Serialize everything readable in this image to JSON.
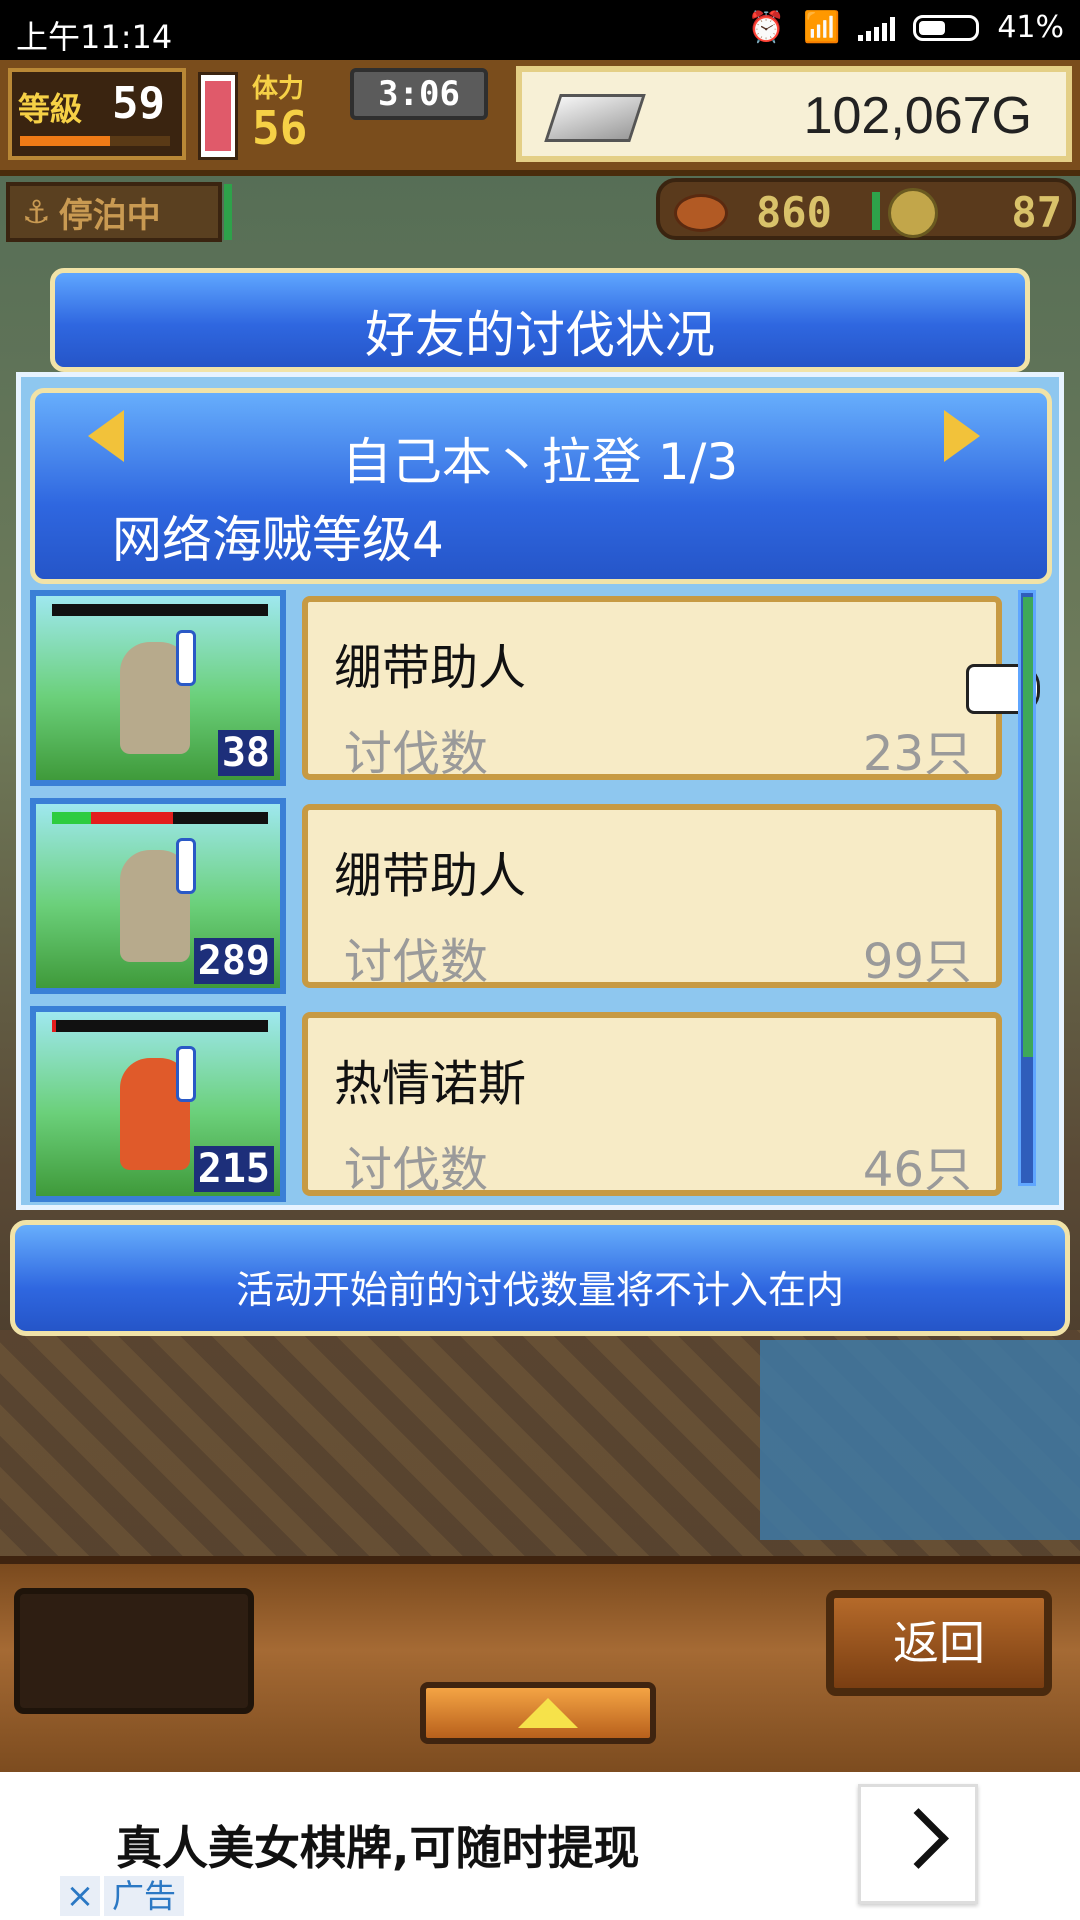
{
  "status_bar": {
    "time": "上午11:14",
    "battery": "41%"
  },
  "top_bar": {
    "level_label": "等級",
    "level_value": "59",
    "stamina_label": "体力",
    "stamina_value": "56",
    "timer": "3:06",
    "gold": "102,067G"
  },
  "anchor_status": "停泊中",
  "resources": {
    "food": "860",
    "coins": "87"
  },
  "panel": {
    "title": "好友的讨伐状况",
    "stage": "自己本丶拉登 1/3",
    "net_level": "网络海贼等级4",
    "rows": [
      {
        "name": "绷带助人",
        "kill_label": "讨伐数",
        "kill_value": "23只",
        "count": "38",
        "hp": {
          "green": 0,
          "red": 0
        },
        "monster_color": "#b7aa8c"
      },
      {
        "name": "绷带助人",
        "kill_label": "讨伐数",
        "kill_value": "99只",
        "count": "289",
        "hp": {
          "green": 0.18,
          "red": 0.38
        },
        "monster_color": "#b7aa8c"
      },
      {
        "name": "热情诺斯",
        "kill_label": "讨伐数",
        "kill_value": "46只",
        "count": "215",
        "hp": {
          "green": 0,
          "red": 0.02
        },
        "monster_color": "#e05a2a"
      }
    ],
    "notice": "活动开始前的讨伐数量将不计入在内"
  },
  "bottom": {
    "back_label": "返回"
  },
  "ad": {
    "text": "真人美女棋牌,可随时提现",
    "close": "×",
    "tag": "广告"
  },
  "icons": [
    "alarm-icon",
    "wifi-icon",
    "signal-icon",
    "battery-icon",
    "silver-ingot-icon",
    "anchor-icon",
    "meat-icon",
    "coin-icon",
    "left-arrow-icon",
    "right-arrow-icon",
    "pointing-hand-icon",
    "up-arrow-icon",
    "chevron-right-icon",
    "close-icon"
  ]
}
